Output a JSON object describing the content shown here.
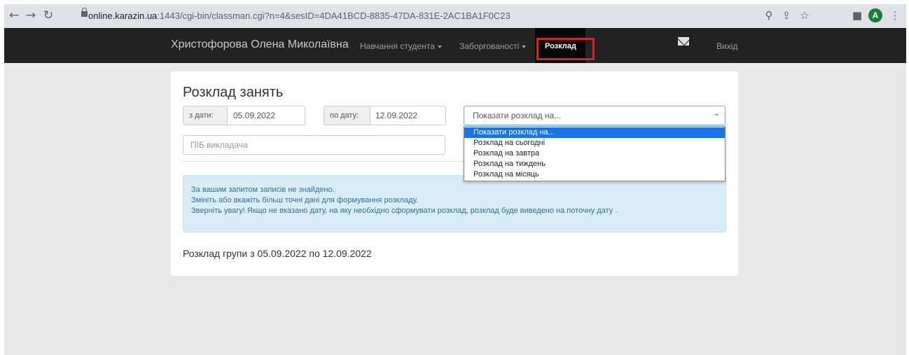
{
  "browser": {
    "url_host": "online.karazin.ua",
    "url_rest": ":1443/cgi-bin/classman.cgi?n=4&sesID=4DA41BCD-8835-47DA-831E-2AC1BA1F0C23",
    "avatar_letter": "A",
    "icons": [
      "back-arrow-icon",
      "forward-arrow-icon",
      "reload-icon",
      "lock-icon",
      "zoom-icon",
      "share-icon",
      "star-icon",
      "sidepanel-icon",
      "menu-icon"
    ]
  },
  "navbar": {
    "user_name": "Христофорова Олена Миколаївна",
    "study_label": "Навчання студента",
    "debts_label": "Заборгованості",
    "schedule_label": "Розклад",
    "logout_label": "Вихід",
    "highlight_color": "#d62228"
  },
  "panel": {
    "title": "Розклад занять",
    "from_label": "з дати:",
    "from_value": "05.09.2022",
    "to_label": "по дату:",
    "to_value": "12.09.2022",
    "select_value": "Показати розклад на...",
    "teacher_placeholder": "ПІБ викладача",
    "alert": {
      "line1": "За вашим запитом записів не знайдено.",
      "line2": "Змініть або вкажіть більш точні дані для формування розкладу.",
      "line3": "Зверніть увагу! Якщо не вказано дату, на яку необхідно сформувати розклад, розклад буде виведено на поточну дату ."
    },
    "group_range": "Розклад групи з 05.09.2022 по 12.09.2022"
  },
  "dropdown": {
    "options": [
      "Показати розклад на...",
      "Розклад на сьогодні",
      "Розклад на завтра",
      "Розклад на тиждень",
      "Розклад на місяць"
    ],
    "selected_index": 0
  },
  "colors": {
    "navbar_bg": "#222222",
    "alert_bg": "#d9edf7",
    "alert_text": "#31708f",
    "option_selected": "#1a73e8"
  }
}
